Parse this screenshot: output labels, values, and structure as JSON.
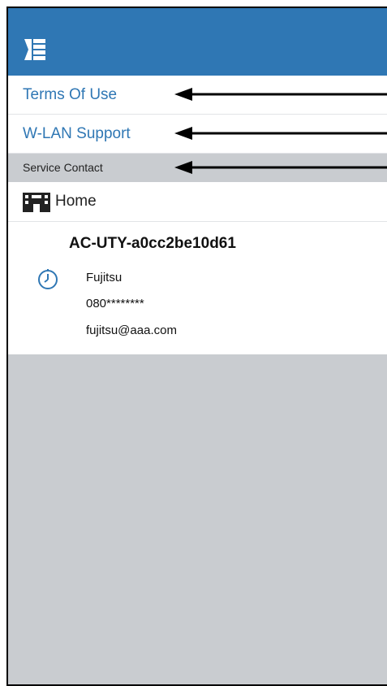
{
  "header": {
    "menu_icon": "menu-toggle-icon",
    "color": "#2f77b4"
  },
  "menu": {
    "terms_label": "Terms Of Use",
    "wlan_label": "W-LAN Support"
  },
  "service_contact": {
    "section_label": "Service Contact",
    "group_icon": "building-icon",
    "group_label": "Home",
    "device": {
      "name": "AC-UTY-a0cc2be10d61",
      "icon": "clock-icon",
      "contact_name": "Fujitsu",
      "phone": "080********",
      "email": "fujitsu@aaa.com"
    }
  },
  "colors": {
    "accent": "#2f77b4",
    "backdrop": "#c9ccd0",
    "callout_arrow": "#000000"
  }
}
